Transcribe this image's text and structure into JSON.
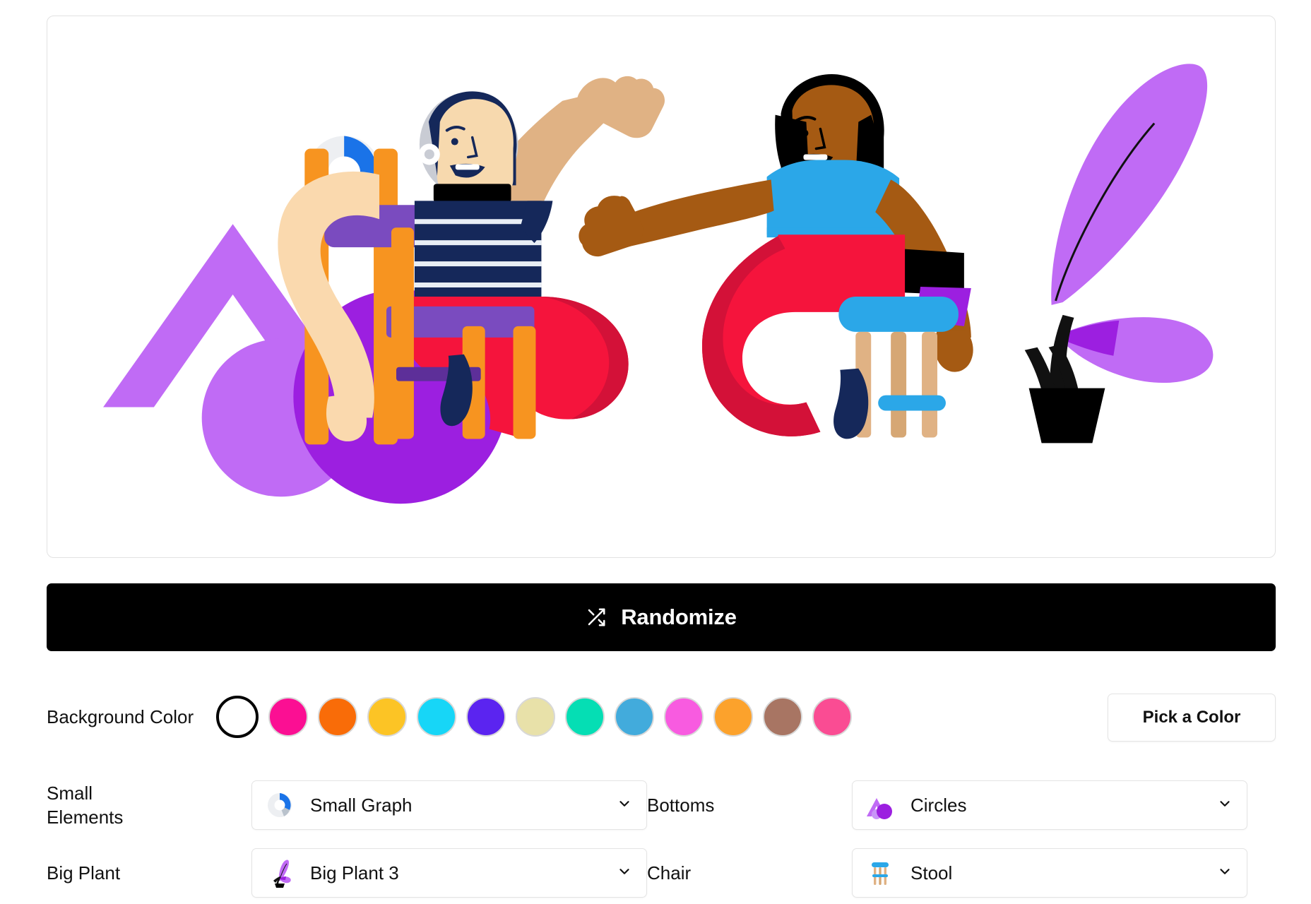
{
  "illustration": {
    "alt": "Two seated characters illustration",
    "palette": {
      "red_skirt": "#F5143C",
      "red_skirt_dark": "#D31138",
      "navy": "#15285A",
      "orange_chair": "#F79420",
      "purple_seat": "#7A4BBF",
      "bright_purple": "#9C1FE0",
      "light_purple": "#C濃",
      "skin_light": "#F7D9AE",
      "skin_dark": "#A55A13",
      "blue_shirt": "#2BA7E8",
      "black": "#000000",
      "silver": "#C9CCD4"
    }
  },
  "randomize": {
    "label": "Randomize",
    "icon": "shuffle-icon",
    "background": "#000000"
  },
  "background_color": {
    "label": "Background Color",
    "pick_button_label": "Pick a Color",
    "selected_index": 0,
    "swatches": [
      {
        "name": "white",
        "hex": "#FFFFFF",
        "selected": true
      },
      {
        "name": "magenta",
        "hex": "#FB0F93",
        "selected": false
      },
      {
        "name": "orange-red",
        "hex": "#F96C08",
        "selected": false
      },
      {
        "name": "yellow",
        "hex": "#FCC425",
        "selected": false
      },
      {
        "name": "cyan",
        "hex": "#17D6F7",
        "selected": false
      },
      {
        "name": "violet",
        "hex": "#5B24F0",
        "selected": false
      },
      {
        "name": "khaki",
        "hex": "#E8E1A9",
        "selected": false
      },
      {
        "name": "turquoise",
        "hex": "#05DEB4",
        "selected": false
      },
      {
        "name": "steel-blue",
        "hex": "#42ABDC",
        "selected": false
      },
      {
        "name": "pink",
        "hex": "#F85BE0",
        "selected": false
      },
      {
        "name": "amber",
        "hex": "#FCA22C",
        "selected": false
      },
      {
        "name": "brown",
        "hex": "#A87563",
        "selected": false
      },
      {
        "name": "hot-pink",
        "hex": "#FA4C93",
        "selected": false
      }
    ]
  },
  "options": [
    {
      "label": "Small\nElements",
      "label_line1": "Small",
      "label_line2": "Elements",
      "value": "Small Graph",
      "icon": "donut-chart-icon"
    },
    {
      "label": "Bottoms",
      "value": "Circles",
      "icon": "triangle-circle-icon"
    },
    {
      "label": "Big Plant",
      "value": "Big Plant 3",
      "icon": "potted-plant-icon"
    },
    {
      "label": "Chair",
      "value": "Stool",
      "icon": "stool-icon"
    }
  ]
}
